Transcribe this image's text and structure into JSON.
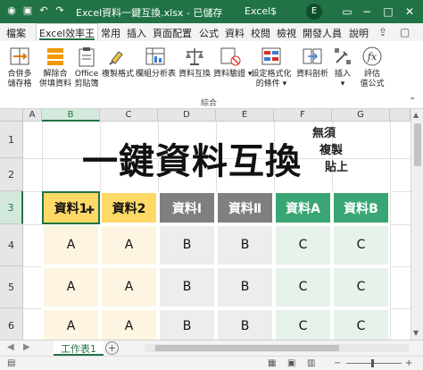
{
  "titlebar": {
    "title": "Excel資料一鍵互換.xlsx  -  已儲存",
    "user": "Excel$",
    "avatar_initial": "E",
    "icons": [
      "autosave-icon",
      "save-icon",
      "undo-icon",
      "redo-icon",
      "customize-icon"
    ]
  },
  "tabs": {
    "items": [
      "檔案",
      "Excel效率王",
      "常用",
      "插入",
      "頁面配置",
      "公式",
      "資料",
      "校閱",
      "檢視",
      "開發人員",
      "說明"
    ],
    "active": "Excel效率王"
  },
  "ribbon": {
    "buttons": [
      {
        "label": "合併多\n儲存格",
        "icon": "merge-cells-icon"
      },
      {
        "label": "解除合\n併填資料",
        "icon": "unmerge-fill-icon"
      },
      {
        "label": "Office\n剪貼簿",
        "icon": "clipboard-icon"
      },
      {
        "label": "複製格式",
        "icon": "format-painter-icon"
      },
      {
        "label": "欄組分析表",
        "icon": "column-analysis-icon"
      },
      {
        "label": "資料互換",
        "icon": "data-swap-icon"
      },
      {
        "label": "資料驗證",
        "icon": "data-validation-icon"
      },
      {
        "label": "設定格式化\n的條件",
        "icon": "conditional-format-icon"
      },
      {
        "label": "資料剖析",
        "icon": "text-to-columns-icon"
      },
      {
        "label": "插入",
        "icon": "insert-icon"
      },
      {
        "label": "評估\n值公式",
        "icon": "evaluate-formula-icon"
      }
    ],
    "group_label": "綜合"
  },
  "grid": {
    "columns": [
      "A",
      "B",
      "C",
      "D",
      "E",
      "F",
      "G"
    ],
    "rows": [
      "1",
      "2",
      "3",
      "4",
      "5",
      "6"
    ],
    "selected_column": "B",
    "selected_row": "3",
    "headline": "一鍵資料互換",
    "sidenote": [
      "無須",
      "複製",
      "貼上"
    ],
    "header_cells": [
      {
        "text": "資料1",
        "bg": "#ffd966",
        "color": "#111111"
      },
      {
        "text": "資料2",
        "bg": "#ffd966",
        "color": "#111111"
      },
      {
        "text": "資料Ⅰ",
        "bg": "#7f7f7f",
        "color": "#ffffff"
      },
      {
        "text": "資料Ⅱ",
        "bg": "#7f7f7f",
        "color": "#ffffff"
      },
      {
        "text": "資料A",
        "bg": "#3aa675",
        "color": "#ffffff"
      },
      {
        "text": "資料B",
        "bg": "#3aa675",
        "color": "#ffffff"
      }
    ],
    "data_rows": [
      [
        "A",
        "A",
        "B",
        "B",
        "C",
        "C"
      ],
      [
        "A",
        "A",
        "B",
        "B",
        "C",
        "C"
      ],
      [
        "A",
        "A",
        "B",
        "B",
        "C",
        "C"
      ]
    ],
    "data_fills": [
      "#fdf5e2",
      "#fdf5e2",
      "#ededed",
      "#ededed",
      "#e6f2ea",
      "#e6f2ea"
    ]
  },
  "sheets": {
    "active": "工作表1",
    "add_label": "+"
  }
}
